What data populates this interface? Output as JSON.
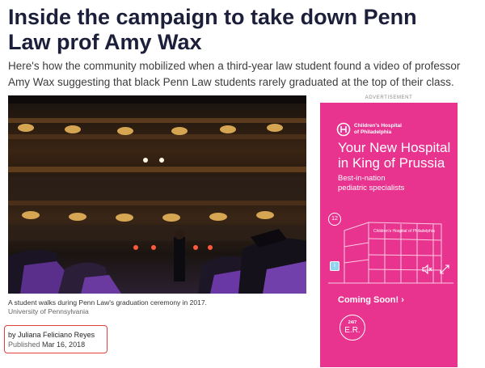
{
  "article": {
    "headline": "Inside the campaign to take down Penn Law prof Amy Wax",
    "dek": "Here's how the community mobilized when a third-year law student found a video of professor Amy Wax suggesting that black Penn Law students rarely graduated at the top of their class.",
    "photo_caption": "A student walks during Penn Law's graduation ceremony in 2017.",
    "photo_credit": "University of Pennsylvania",
    "byline_prefix": "by",
    "author": "Juliana Feliciano Reyes",
    "published_label": "Published",
    "published_date": "Mar 16, 2018"
  },
  "advertisement": {
    "label": "ADVERTISEMENT",
    "logo_line1": "Children's Hospital",
    "logo_line2": "of Philadelphia",
    "headline_line1": "Your New Hospital",
    "headline_line2": "in King of Prussia",
    "sub_line1": "Best-in-nation",
    "sub_line2": "pediatric specialists",
    "badge_number": "12",
    "coming_soon": "Coming Soon!",
    "coming_soon_arrow": "›",
    "er_top": "24/7",
    "er_main": "E.R.",
    "info_glyph": "i",
    "building_sign": "Children's Hospital of Philadelphia",
    "brand_color": "#e8338f"
  },
  "colors": {
    "headline": "#1c1f3a",
    "byline_highlight": "#e0403a"
  }
}
